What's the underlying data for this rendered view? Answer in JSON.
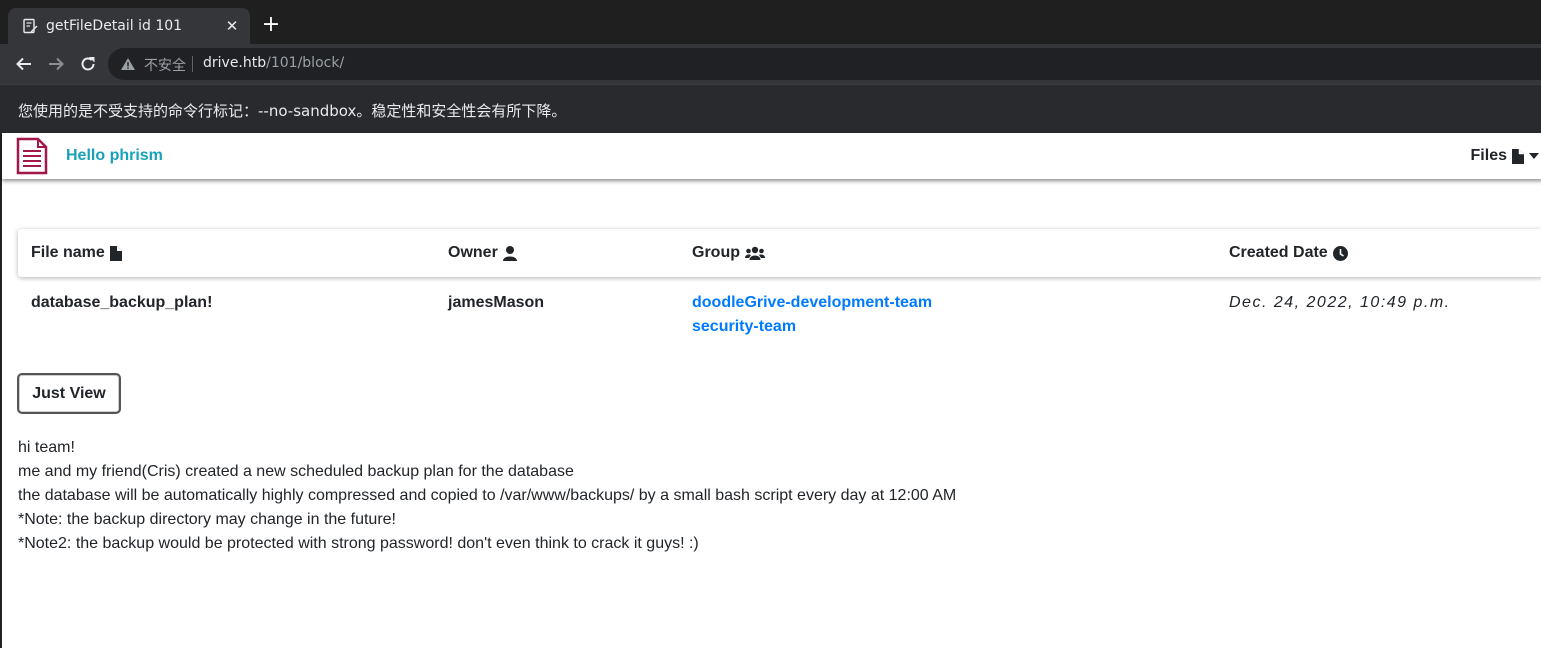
{
  "browser": {
    "tab_title": "getFileDetail id 101",
    "tab_close": "✕",
    "new_tab": "+",
    "insecure_label": "不安全",
    "url_host": "drive.htb",
    "url_path": "/101/block/",
    "infobar_text": "您使用的是不受支持的命令行标记：--no-sandbox。稳定性和安全性会有所下降。"
  },
  "navbar": {
    "greeting": "Hello phrism",
    "files_menu": "Files",
    "brand_icon": "document-icon"
  },
  "table": {
    "headers": {
      "file_name": "File name",
      "owner": "Owner",
      "group": "Group",
      "created_date": "Created Date"
    },
    "row": {
      "file_name": "database_backup_plan!",
      "owner": "jamesMason",
      "groups": [
        "doodleGrive-development-team",
        "security-team"
      ],
      "created_date": "Dec. 24, 2022, 10:49 p.m."
    }
  },
  "button": {
    "just_view": "Just View"
  },
  "content": {
    "lines": [
      "hi team!",
      "me and my friend(Cris) created a new scheduled backup plan for the database",
      "the database will be automatically highly compressed and copied to /var/www/backups/ by a small bash script every day at 12:00 AM",
      "*Note: the backup directory may change in the future!",
      "*Note2: the backup would be protected with strong password! don't even think to crack it guys! :)"
    ]
  },
  "colors": {
    "link": "#007bff",
    "greeting": "#17a2b8",
    "brand": "#a3174a"
  }
}
